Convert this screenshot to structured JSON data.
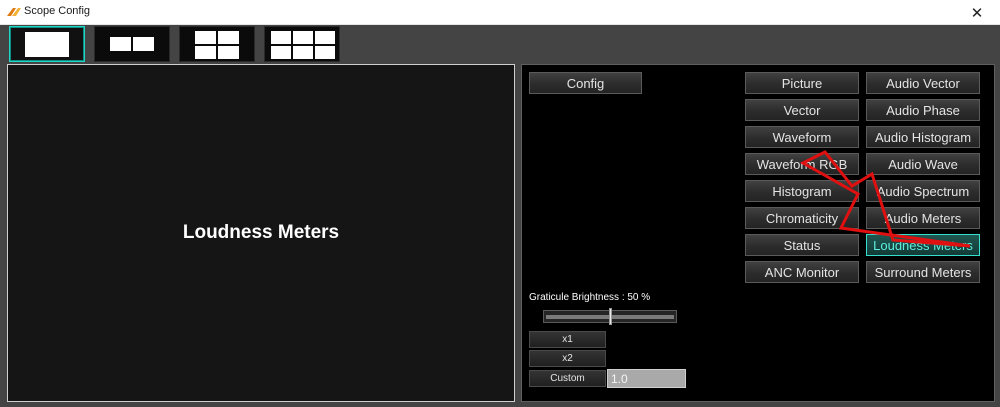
{
  "window": {
    "title": "Scope Config",
    "close_glyph": "✕"
  },
  "layout_options": [
    {
      "name": "single",
      "selected": true
    },
    {
      "name": "two-column",
      "selected": false
    },
    {
      "name": "2x2-grid",
      "selected": false
    },
    {
      "name": "3x2-grid",
      "selected": false
    }
  ],
  "preview": {
    "title": "Loudness Meters"
  },
  "panel": {
    "config_label": "Config",
    "scopes_left": [
      "Picture",
      "Vector",
      "Waveform",
      "Waveform RGB",
      "Histogram",
      "Chromaticity",
      "Status",
      "ANC Monitor"
    ],
    "scopes_right": [
      "Audio Vector",
      "Audio Phase",
      "Audio Histogram",
      "Audio Wave",
      "Audio Spectrum",
      "Audio Meters",
      "Loudness Meters",
      "Surround Meters"
    ],
    "selected_scope": "Loudness Meters",
    "graticule_label": "Graticule Brightness : 50 %",
    "graticule_value": 50,
    "zoom": {
      "x1": "x1",
      "x2": "x2",
      "custom": "Custom",
      "custom_value": "1.0"
    }
  },
  "colors": {
    "accent": "#1fd7c4",
    "annotation_arrow": "#e01010"
  },
  "icons": {
    "app": "app-logo-icon",
    "close": "close-icon"
  }
}
